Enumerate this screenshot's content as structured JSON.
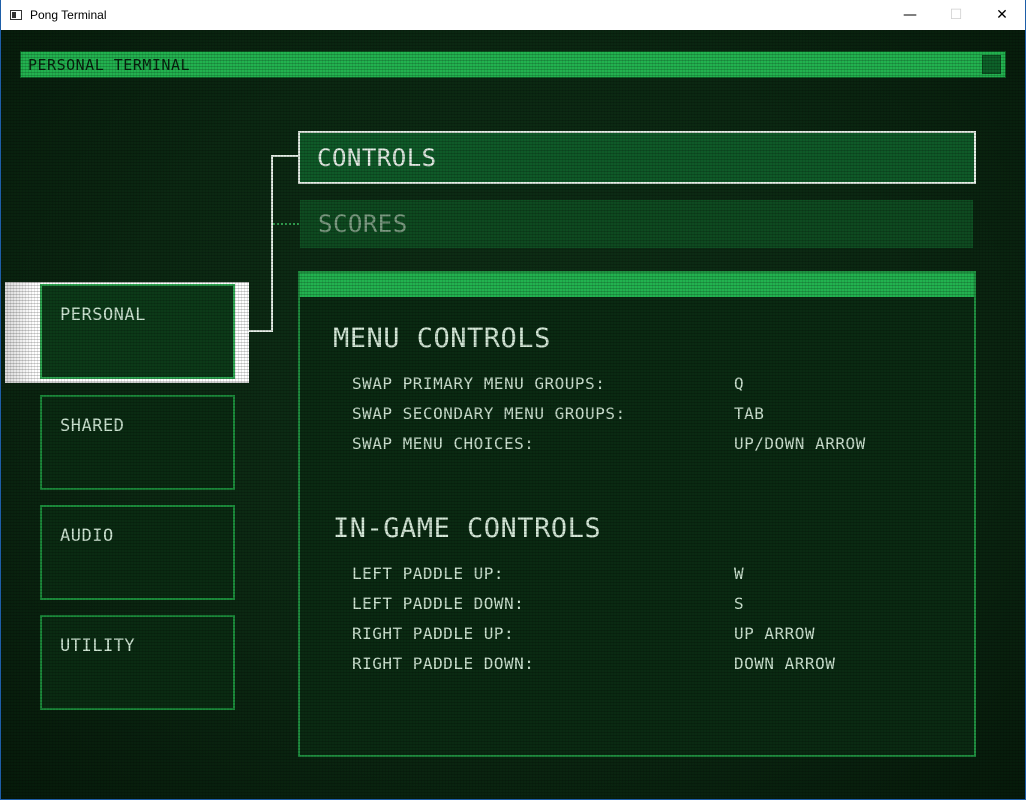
{
  "window": {
    "title": "Pong Terminal",
    "minimize": "—",
    "maximize": "☐",
    "close": "✕"
  },
  "terminal": {
    "header": "PERSONAL TERMINAL"
  },
  "side_menu": [
    {
      "label": "PERSONAL",
      "active": true
    },
    {
      "label": "SHARED",
      "active": false
    },
    {
      "label": "AUDIO",
      "active": false
    },
    {
      "label": "UTILITY",
      "active": false
    }
  ],
  "tabs": [
    {
      "label": "CONTROLS",
      "active": true
    },
    {
      "label": "SCORES",
      "active": false
    }
  ],
  "sections": [
    {
      "title": "MENU CONTROLS",
      "rows": [
        {
          "label": "SWAP PRIMARY MENU GROUPS:",
          "value": "Q"
        },
        {
          "label": "SWAP SECONDARY MENU GROUPS:",
          "value": "TAB"
        },
        {
          "label": "SWAP MENU CHOICES:",
          "value": "UP/DOWN ARROW"
        }
      ]
    },
    {
      "title": "IN-GAME CONTROLS",
      "rows": [
        {
          "label": "LEFT PADDLE UP:",
          "value": "W"
        },
        {
          "label": "LEFT PADDLE DOWN:",
          "value": "S"
        },
        {
          "label": "RIGHT PADDLE UP:",
          "value": "UP ARROW"
        },
        {
          "label": "RIGHT PADDLE DOWN:",
          "value": "DOWN ARROW"
        }
      ]
    }
  ],
  "colors": {
    "accent_green": "#22b24f",
    "background": "#0b2812",
    "text": "#cfe5d3"
  }
}
